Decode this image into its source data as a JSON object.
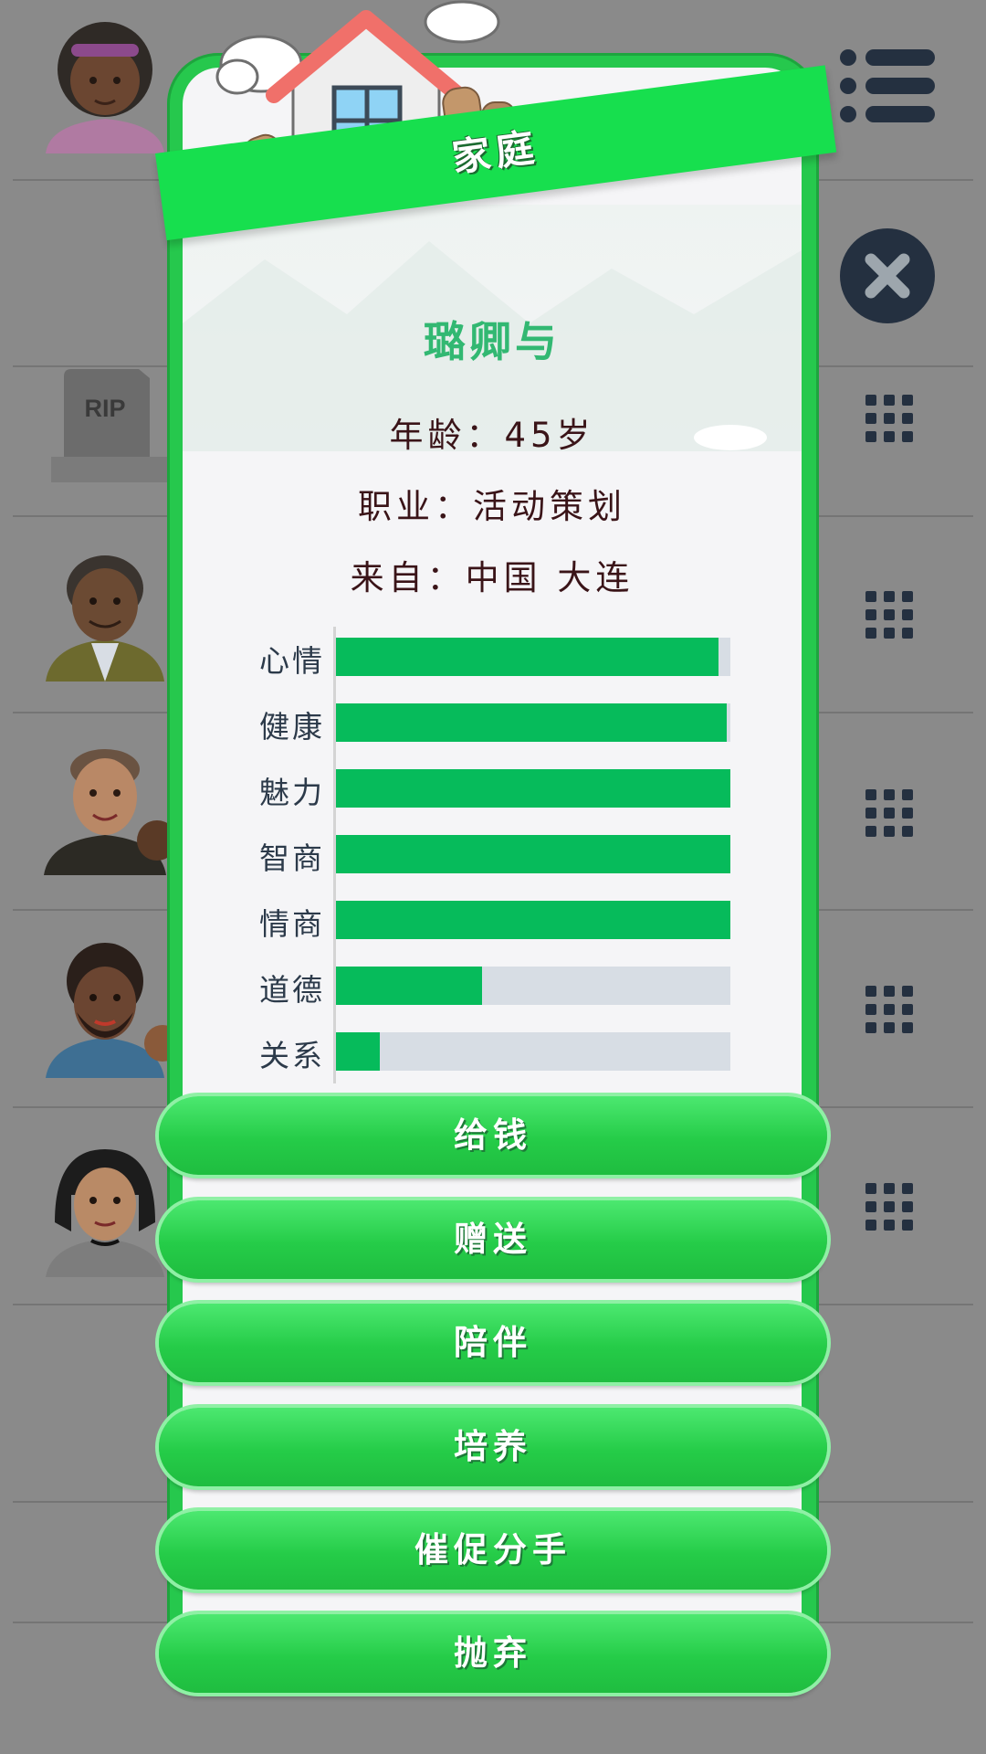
{
  "dialog": {
    "title": "家庭",
    "name": "璐卿与",
    "age_line": "年龄：45岁",
    "job_line": "职业：活动策划",
    "from_line": "来自：中国 大连"
  },
  "stats": [
    {
      "label": "心情",
      "value": 0.97
    },
    {
      "label": "健康",
      "value": 0.99
    },
    {
      "label": "魅力",
      "value": 1.0
    },
    {
      "label": "智商",
      "value": 1.0
    },
    {
      "label": "情商",
      "value": 1.0
    },
    {
      "label": "道德",
      "value": 0.37
    },
    {
      "label": "关系",
      "value": 0.11
    }
  ],
  "actions": [
    {
      "label": "给钱"
    },
    {
      "label": "赠送"
    },
    {
      "label": "陪伴"
    },
    {
      "label": "培养"
    },
    {
      "label": "催促分手"
    },
    {
      "label": "抛弃"
    }
  ],
  "background": {
    "tombstone_text": "RIP"
  },
  "colors": {
    "frame": "#26c84d",
    "ribbon": "#17df4e",
    "bar_fill": "#06bb5b",
    "bar_track": "#d7dde4",
    "name": "#32b872",
    "icon_dark": "#243040"
  },
  "icons": [
    "menu-icon",
    "close-icon",
    "grid-icon",
    "house-icon",
    "cloud-icon"
  ]
}
